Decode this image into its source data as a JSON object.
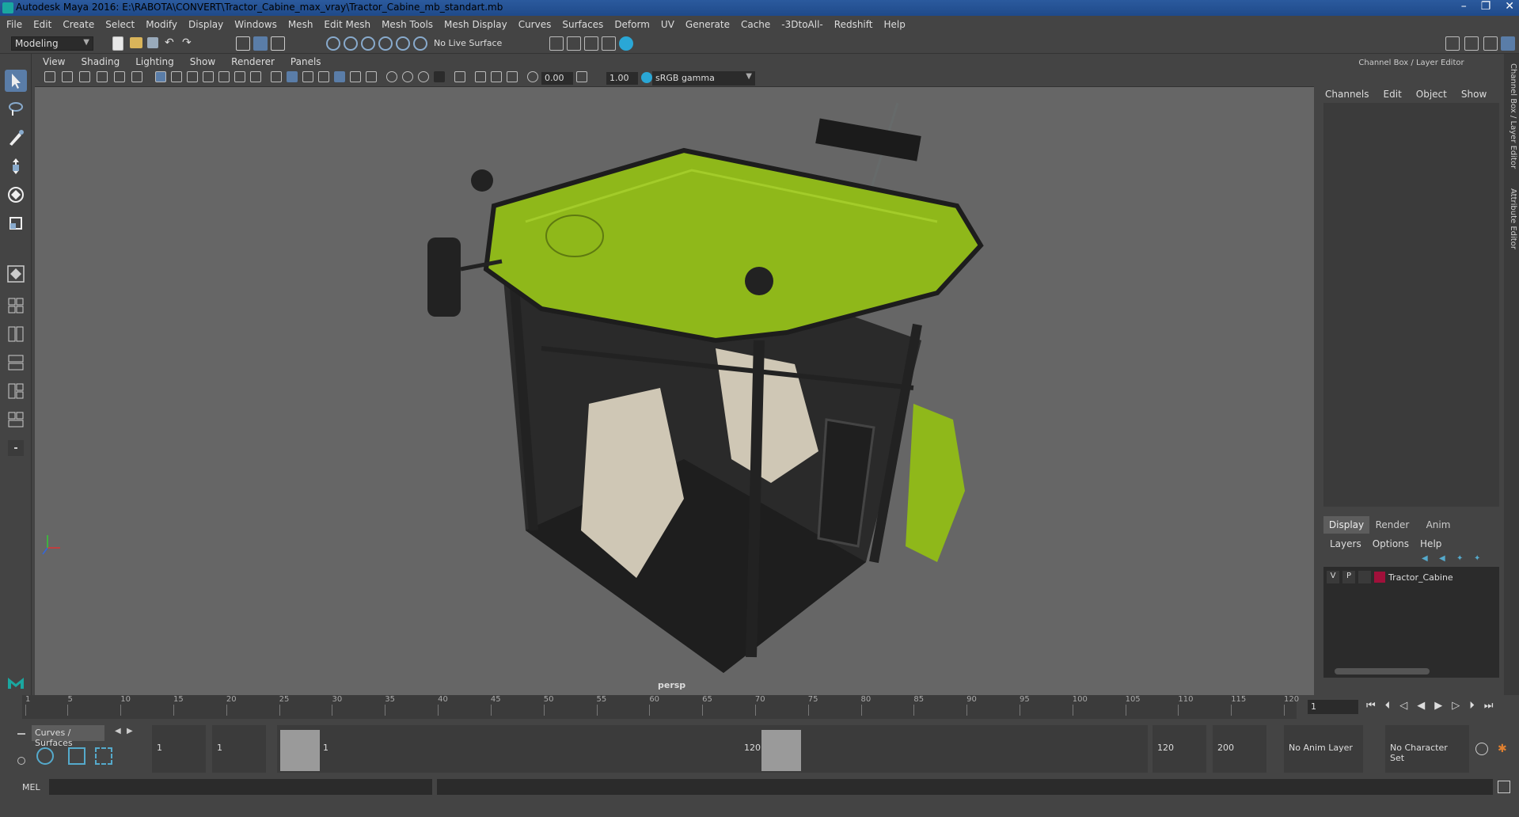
{
  "window": {
    "title": "Autodesk Maya 2016: E:\\RABOTA\\CONVERT\\Tractor_Cabine_max_vray\\Tractor_Cabine_mb_standart.mb",
    "controls": [
      "–",
      "❐",
      "✕"
    ]
  },
  "menubar": {
    "items": [
      "File",
      "Edit",
      "Create",
      "Select",
      "Modify",
      "Display",
      "Windows",
      "Mesh",
      "Edit Mesh",
      "Mesh Tools",
      "Mesh Display",
      "Curves",
      "Surfaces",
      "Deform",
      "UV",
      "Generate",
      "Cache",
      "-3DtoAll-",
      "Redshift",
      "Help"
    ]
  },
  "statusline": {
    "mode": "Modeling",
    "live_surface": "No Live Surface"
  },
  "viewport": {
    "menu": [
      "View",
      "Shading",
      "Lighting",
      "Show",
      "Renderer",
      "Panels"
    ],
    "exposure": "0.00",
    "gamma": "1.00",
    "color_space": "sRGB gamma",
    "camera_label": "persp"
  },
  "right_panel": {
    "title": "Channel Box / Layer Editor",
    "channel_menu": [
      "Channels",
      "Edit",
      "Object",
      "Show"
    ],
    "layer_tabs": [
      "Display",
      "Render",
      "Anim"
    ],
    "active_layer_tab": "Display",
    "layer_menu": [
      "Layers",
      "Options",
      "Help"
    ],
    "layers": [
      {
        "v": "V",
        "p": "P",
        "name": "Tractor_Cabine",
        "color": "#a0103a"
      }
    ],
    "side_tabs": [
      "Channel Box / Layer Editor",
      "Attribute Editor"
    ]
  },
  "timeline": {
    "ticks": [
      "1",
      "5",
      "10",
      "15",
      "20",
      "25",
      "30",
      "35",
      "40",
      "45",
      "50",
      "55",
      "60",
      "65",
      "70",
      "75",
      "80",
      "85",
      "90",
      "95",
      "100",
      "105",
      "110",
      "115",
      "120"
    ],
    "current_frame": "1"
  },
  "range": {
    "shelf_tab": "Curves / Surfaces",
    "start_field": "1",
    "playback_start": "1",
    "range_start_label": "1",
    "range_end_label": "120",
    "playback_end": "120",
    "end_field": "200",
    "anim_layer": "No Anim Layer",
    "character_set": "No Character Set"
  },
  "commandline": {
    "label": "MEL"
  },
  "colors": {
    "accent": "#5a7da8",
    "cab_green": "#8fb81a",
    "layer_color": "#a0103a"
  }
}
